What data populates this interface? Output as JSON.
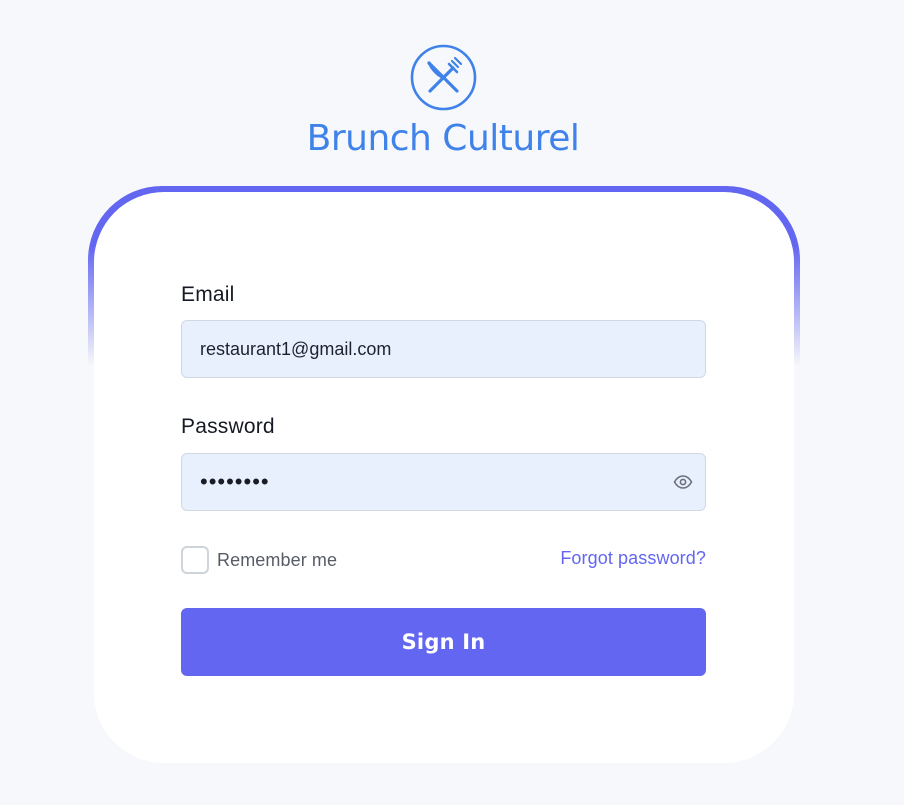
{
  "brand": {
    "name": "Brunch Culturel",
    "logo_icon": "fork-knife-crossed-icon",
    "color": "#3f82ea"
  },
  "form": {
    "email": {
      "label": "Email",
      "value": "restaurant1@gmail.com"
    },
    "password": {
      "label": "Password",
      "value": "password",
      "toggle_icon": "eye-icon"
    },
    "remember_me": {
      "label": "Remember me",
      "checked": false
    },
    "forgot_password_label": "Forgot password?",
    "submit_label": "Sign In"
  },
  "colors": {
    "accent": "#6366f1",
    "background": "#f7f8fb",
    "input_fill": "#e8f0fe"
  }
}
